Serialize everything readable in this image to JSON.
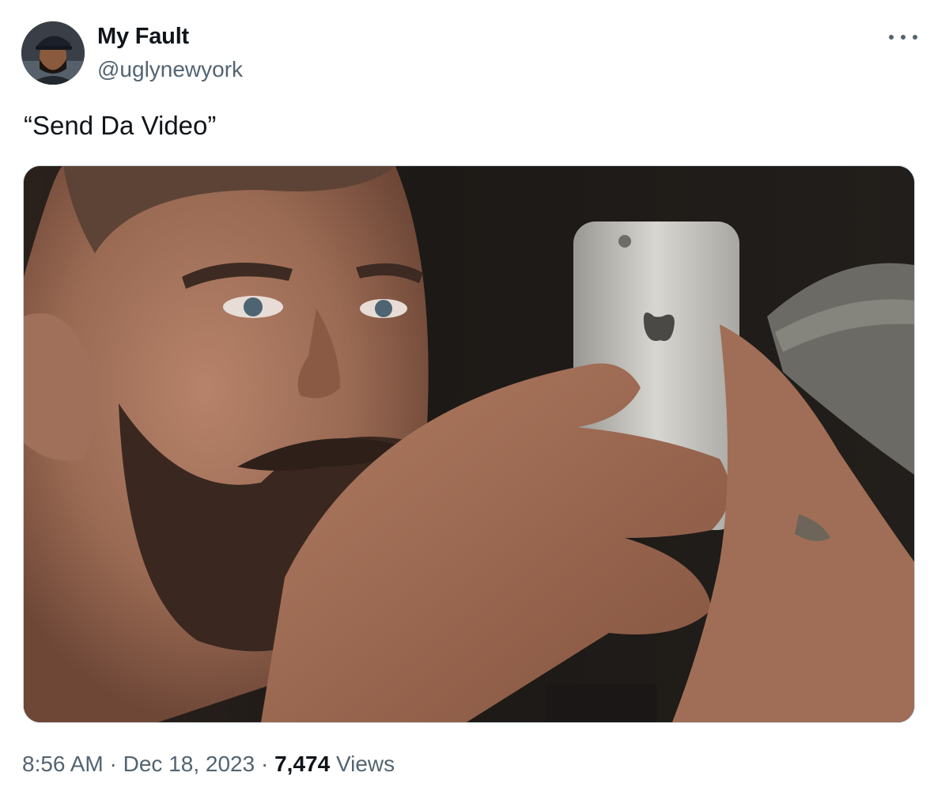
{
  "author": {
    "display_name": "My Fault",
    "handle": "@uglynewyork"
  },
  "tweet": {
    "text": "“Send Da Video”"
  },
  "meta": {
    "time": "8:56 AM",
    "separator1": " · ",
    "date": "Dec 18, 2023",
    "separator2": " · ",
    "views_count": "7,474",
    "views_label": " Views"
  },
  "icons": {
    "more": "more-horizontal-icon"
  },
  "colors": {
    "text_primary": "#0f1419",
    "text_secondary": "#536471",
    "border": "#cfd9de"
  }
}
